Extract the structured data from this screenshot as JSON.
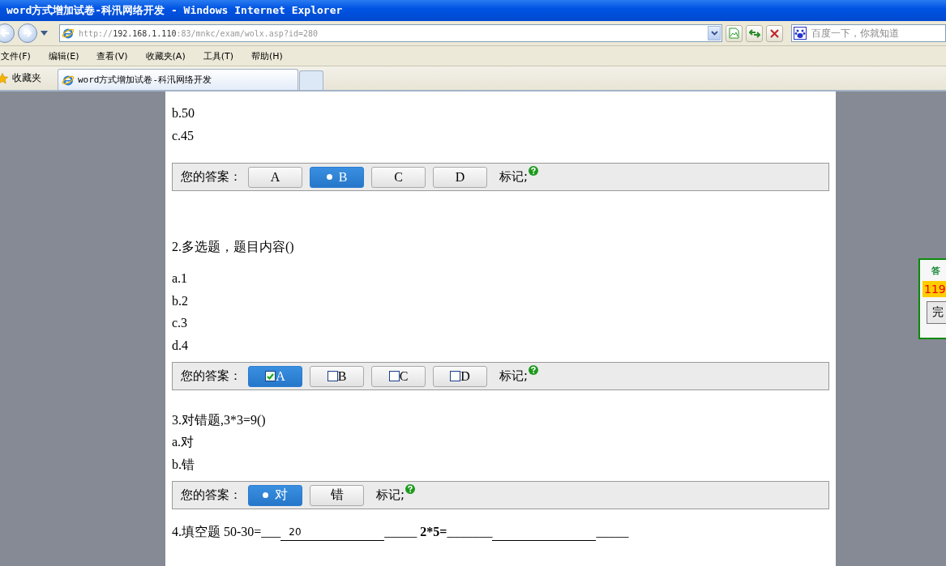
{
  "window": {
    "title": "word方式增加试卷-科汛网络开发 - Windows Internet Explorer"
  },
  "address_bar": {
    "scheme": "http://",
    "host": "192.168.1.110",
    "path": ":83/mnkc/exam/wolx.asp?id=280"
  },
  "search": {
    "placeholder": "百度一下，你就知道"
  },
  "menu": [
    "文件(F)",
    "编辑(E)",
    "查看(V)",
    "收藏夹(A)",
    "工具(T)",
    "帮助(H)"
  ],
  "favorites": {
    "label": "收藏夹"
  },
  "tabs": [
    {
      "label": "word方式增加试卷-科汛网络开发",
      "selected": true
    }
  ],
  "questions": [
    {
      "options": [
        "b.50",
        "c.45"
      ],
      "answer": {
        "kind": "radio",
        "label": "您的答案：",
        "mark_label": "标记;",
        "choices": [
          {
            "label": "A",
            "selected": false
          },
          {
            "label": "B",
            "selected": true
          },
          {
            "label": "C",
            "selected": false
          },
          {
            "label": "D",
            "selected": false
          }
        ]
      }
    },
    {
      "title": "2.多选题，题目内容()",
      "options": [
        "a.1",
        "b.2",
        "c.3",
        "d.4"
      ],
      "answer": {
        "kind": "checkbox",
        "label": "您的答案：",
        "mark_label": "标记;",
        "choices": [
          {
            "label": "A",
            "selected": true
          },
          {
            "label": "B",
            "selected": false
          },
          {
            "label": "C",
            "selected": false
          },
          {
            "label": "D",
            "selected": false
          }
        ]
      }
    },
    {
      "title": "3.对错题,3*3=9()",
      "options": [
        "a.对",
        "b.错"
      ],
      "answer": {
        "kind": "radio",
        "label": "您的答案：",
        "mark_label": "标记;",
        "choices": [
          {
            "label": "对",
            "selected": true
          },
          {
            "label": "错",
            "selected": false
          }
        ]
      }
    },
    {
      "fill": [
        {
          "kind": "text",
          "text": "4.填空题 50-30="
        },
        {
          "kind": "blank",
          "text": "___"
        },
        {
          "kind": "input",
          "value": "20"
        },
        {
          "kind": "blank",
          "text": "_____"
        },
        {
          "kind": "bold",
          "text": " 2*5="
        },
        {
          "kind": "blank",
          "text": "_______"
        },
        {
          "kind": "input"
        },
        {
          "kind": "blank",
          "text": "_____"
        }
      ]
    }
  ],
  "side_panel": {
    "title": "答",
    "timer": "119",
    "button": "完"
  }
}
